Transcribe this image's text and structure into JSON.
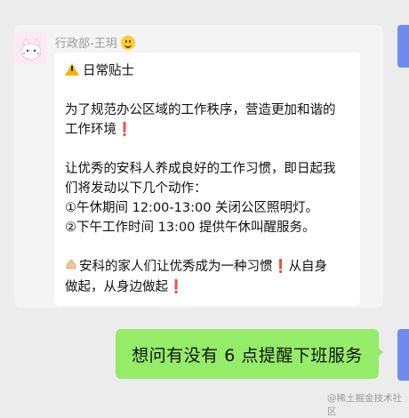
{
  "chat": {
    "sender_name": "行政部-王玥",
    "sender_emoji_icon": "smiling-face-icon",
    "message_lines": [
      "日常贴士",
      "为了规范办公区域的工作秩序，营造更加和谐的",
      "工作环境",
      "让优秀的安科人养成良好的工作习惯，即日起我",
      "们将发动以下几个动作：",
      "①午休期间 12:00-13:00 关闭公区照明灯。",
      "②下午工作时间 13:00 提供午休叫醒服务。",
      "安科的家人们让优秀成为一种习惯",
      "从自身",
      "做起，从身边做起"
    ],
    "excl_mark": "❗",
    "reply_text": "想问有没有 6 点提醒下班服务"
  },
  "watermark": "@稀土掘金技术社区",
  "colors": {
    "reply_bubble": "#95ec69",
    "accent_strip": "#6e8bf0",
    "exclamation": "#e0202a",
    "warning": "#f2b600"
  }
}
